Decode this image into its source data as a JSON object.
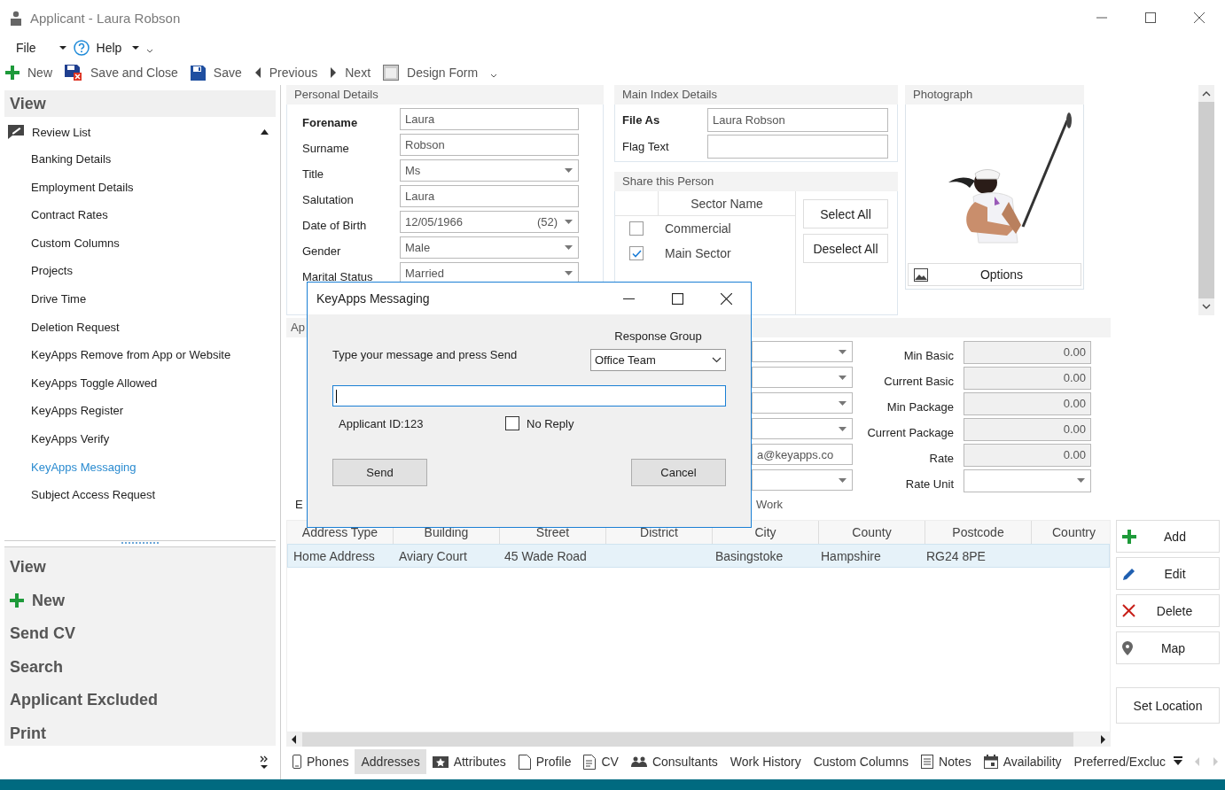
{
  "window": {
    "title": "Applicant - Laura Robson"
  },
  "menu": [
    {
      "label": "File",
      "kind": "plain"
    },
    {
      "label": "Help",
      "kind": "help"
    }
  ],
  "toolbar": [
    {
      "label": "New",
      "kind": "new"
    },
    {
      "label": "Save and Close",
      "kind": "save-close"
    },
    {
      "label": "Save",
      "kind": "save"
    },
    {
      "label": "Previous",
      "kind": "previous"
    },
    {
      "label": "Next",
      "kind": "next"
    },
    {
      "label": "Design Form",
      "kind": "design"
    }
  ],
  "sidebar": {
    "header": "View",
    "group": {
      "label": "Review List",
      "expanded": true
    },
    "items": [
      {
        "label": "Banking Details",
        "selected": false
      },
      {
        "label": "Employment Details",
        "selected": false
      },
      {
        "label": "Contract Rates",
        "selected": false
      },
      {
        "label": "Custom Columns",
        "selected": false
      },
      {
        "label": "Projects",
        "selected": false
      },
      {
        "label": "Drive Time",
        "selected": false
      },
      {
        "label": "Deletion Request",
        "selected": false
      },
      {
        "label": "KeyApps Remove from App or Website",
        "selected": false
      },
      {
        "label": "KeyApps Toggle Allowed",
        "selected": false
      },
      {
        "label": "KeyApps Register",
        "selected": false
      },
      {
        "label": "KeyApps Verify",
        "selected": false
      },
      {
        "label": "KeyApps Messaging",
        "selected": true
      },
      {
        "label": "Subject Access Request",
        "selected": false
      }
    ]
  },
  "actions": [
    {
      "label": "View",
      "kind": "plain"
    },
    {
      "label": "New",
      "kind": "new"
    },
    {
      "label": "Send CV",
      "kind": "plain"
    },
    {
      "label": "Search",
      "kind": "plain"
    },
    {
      "label": "Applicant Excluded",
      "kind": "plain"
    },
    {
      "label": "Print",
      "kind": "plain"
    }
  ],
  "personal_details": {
    "title": "Personal Details",
    "fields": [
      {
        "label": "Forename",
        "value": "Laura",
        "kind": "text",
        "required": true
      },
      {
        "label": "Surname",
        "value": "Robson",
        "kind": "text",
        "required": false
      },
      {
        "label": "Title",
        "value": "Ms",
        "kind": "dropdown",
        "required": false
      },
      {
        "label": "Salutation",
        "value": "Laura",
        "kind": "text",
        "required": false
      },
      {
        "label": "Date of Birth",
        "value": "12/05/1966",
        "extra": "(52)",
        "kind": "dropdown",
        "required": false
      },
      {
        "label": "Gender",
        "value": "Male",
        "kind": "dropdown",
        "required": false
      },
      {
        "label": "Marital Status",
        "value": "Married",
        "kind": "dropdown",
        "required": false
      }
    ]
  },
  "main_index": {
    "title": "Main Index Details",
    "fields": [
      {
        "label": "File As",
        "value": "Laura Robson",
        "required": true
      },
      {
        "label": "Flag Text",
        "required": false
      }
    ]
  },
  "share": {
    "title": "Share this Person",
    "column": "Sector Name",
    "sectors": [
      {
        "name": "Commercial",
        "checked": false
      },
      {
        "name": "Main Sector",
        "checked": true
      }
    ],
    "buttons": [
      "Select All",
      "Deselect All"
    ]
  },
  "photograph": {
    "title": "Photograph",
    "button": "Options"
  },
  "applicant_section": {
    "title": "Ap",
    "fields": [
      {
        "kind": "dropdown"
      },
      {
        "kind": "dropdown"
      },
      {
        "kind": "dropdown"
      },
      {
        "kind": "dropdown"
      },
      {
        "kind": "text",
        "value": "a@keyapps.co"
      },
      {
        "kind": "dropdown"
      }
    ],
    "footer_left": "E",
    "footer_right": "Work"
  },
  "pay": [
    {
      "label": "Min Basic",
      "value": "0.00",
      "kind": "number"
    },
    {
      "label": "Current Basic",
      "value": "0.00",
      "kind": "number"
    },
    {
      "label": "Min Package",
      "value": "0.00",
      "kind": "number"
    },
    {
      "label": "Current Package",
      "value": "0.00",
      "kind": "number"
    },
    {
      "label": "Rate",
      "value": "0.00",
      "kind": "number"
    },
    {
      "label": "Rate Unit",
      "kind": "dropdown"
    }
  ],
  "addresses": {
    "columns": [
      "Address Type",
      "Building",
      "Street",
      "District",
      "City",
      "County",
      "Postcode",
      "Country"
    ],
    "rows": [
      {
        "cells": [
          "Home Address",
          "Aviary Court",
          "45 Wade Road",
          null,
          "Basingstoke",
          "Hampshire",
          "RG24 8PE",
          null
        ],
        "selected": true
      }
    ]
  },
  "address_buttons": [
    {
      "label": "Add",
      "kind": "add"
    },
    {
      "label": "Edit",
      "kind": "edit"
    },
    {
      "label": "Delete",
      "kind": "delete"
    },
    {
      "label": "Map",
      "kind": "map"
    },
    {
      "label": "Set Location",
      "kind": "plain"
    }
  ],
  "tabs": [
    {
      "label": "Phones",
      "kind": "phone",
      "selected": false
    },
    {
      "label": "Addresses",
      "kind": "none",
      "selected": true
    },
    {
      "label": "Attributes",
      "kind": "attributes",
      "selected": false
    },
    {
      "label": "Profile",
      "kind": "document",
      "selected": false
    },
    {
      "label": "CV",
      "kind": "cv",
      "selected": false
    },
    {
      "label": "Consultants",
      "kind": "people",
      "selected": false
    },
    {
      "label": "Work History",
      "kind": "none",
      "selected": false
    },
    {
      "label": "Custom Columns",
      "kind": "none",
      "selected": false
    },
    {
      "label": "Notes",
      "kind": "notes",
      "selected": false
    },
    {
      "label": "Availability",
      "kind": "calendar",
      "selected": false
    },
    {
      "label": "Preferred/Excluc",
      "kind": "none",
      "selected": false
    }
  ],
  "dialog": {
    "title": "KeyApps Messaging",
    "prompt": "Type your message and press Send",
    "group_label": "Response Group",
    "group_value": "Office Team",
    "applicant_id": "Applicant ID:123",
    "no_reply": {
      "label": "No Reply",
      "checked": false
    },
    "buttons": [
      "Send",
      "Cancel"
    ]
  }
}
